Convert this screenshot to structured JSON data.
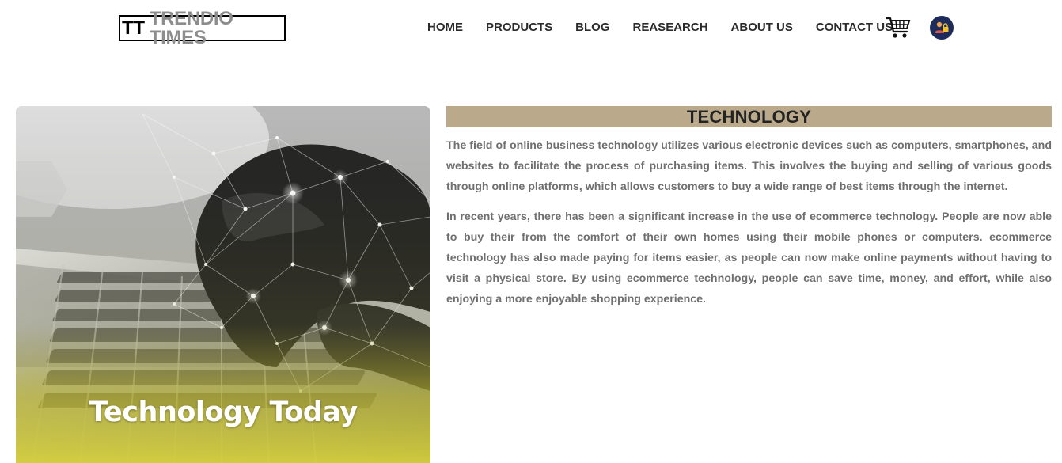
{
  "logo": {
    "mark": "TT",
    "name": "TRENDIO TIMES"
  },
  "nav": {
    "items": [
      {
        "label": "HOME"
      },
      {
        "label": "PRODUCTS"
      },
      {
        "label": "BLOG"
      },
      {
        "label": "REASEARCH"
      },
      {
        "label": "ABOUT US"
      },
      {
        "label": "CONTACT US"
      }
    ],
    "cart_icon": "shopping-cart-icon",
    "account_icon": "user-lock-icon"
  },
  "hero": {
    "caption": "Technology Today",
    "image": "hands-typing-on-laptop-with-network-overlay"
  },
  "article": {
    "title": "TECHNOLOGY",
    "paragraphs": [
      "The field of online business technology utilizes various electronic devices such as computers, smartphones, and websites to facilitate the process of purchasing items. This involves the buying and selling of various goods through online platforms, which allows customers to buy a wide range of best items through the internet.",
      "In recent years, there has been a significant increase in the use of ecommerce technology. People are now able to buy their from the comfort of their own homes using their mobile phones or computers. ecommerce technology has also made paying for items easier, as people can now make online payments without having to visit a physical store. By using ecommerce technology, people can save time, money, and effort, while also enjoying a more enjoyable shopping experience."
    ]
  },
  "colors": {
    "heading_bar": "#baa98b",
    "body_text": "#6f6f6f",
    "nav_text": "#2b2b2b",
    "logo_name": "#8d8d8d",
    "avatar_bg": "#1d2b5a",
    "hero_tint": "#d4cf3a"
  }
}
